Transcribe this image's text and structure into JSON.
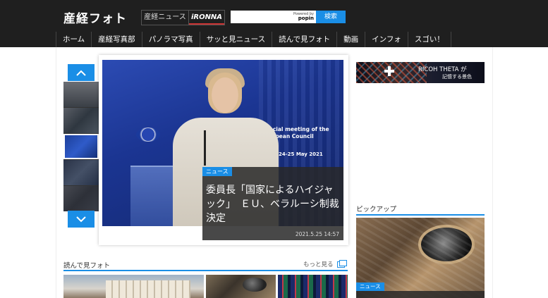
{
  "header": {
    "logo_text": "産経フォト",
    "site_links": [
      "産経ニュース",
      "iRONNA"
    ],
    "search": {
      "placeholder": "",
      "powered_by": "Powered by",
      "popin": "popin",
      "button_label": "検索"
    }
  },
  "nav": {
    "items": [
      "ホーム",
      "産経写真部",
      "パノラマ写真",
      "サッと見ニュース",
      "読んで見フォト",
      "動画",
      "インフォ",
      "スゴい！"
    ]
  },
  "slider": {
    "active_index": 2,
    "main": {
      "category": "ニュース",
      "title": "委員長「国家によるハイジャック」　ＥＵ、ベラルーシ制裁決定",
      "date": "2021.5.25 14:57",
      "photo_text": [
        "Special meeting of the",
        "European Council",
        "24-25 May  2021"
      ]
    }
  },
  "ad": {
    "line1": "RICOH THETA が",
    "line2": "記憶する景色"
  },
  "sections": {
    "pickup": {
      "title": "ピックアップ",
      "category": "ニュース"
    },
    "yonde": {
      "title": "読んで見フォト",
      "more_label": "もっと見る"
    }
  },
  "colors": {
    "accent": "#1a8ee6",
    "header_bg": "#1f1f1f"
  }
}
